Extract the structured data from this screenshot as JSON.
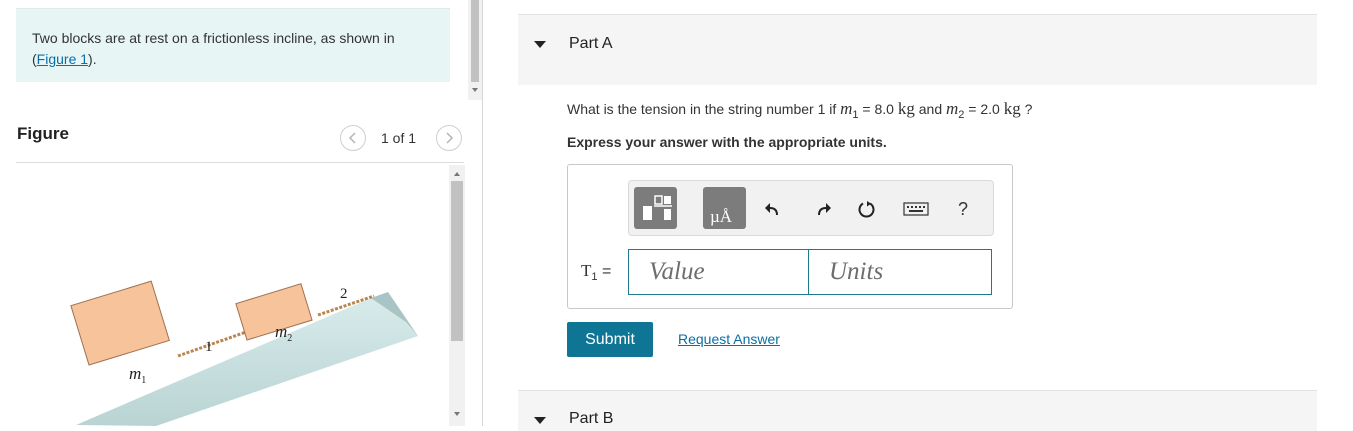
{
  "problem": {
    "text": "Two blocks are at rest on a frictionless incline, as shown in (",
    "link": "Figure 1",
    "suffix": ")."
  },
  "figure": {
    "title": "Figure",
    "counter": "1 of 1",
    "labels": {
      "mass1": "m",
      "mass1_sub": "1",
      "mass2": "m",
      "mass2_sub": "2",
      "string1": "1",
      "string2": "2"
    }
  },
  "part_a": {
    "label": "Part A",
    "question_prefix": "What is the tension in the string number 1 if ",
    "m1_var": "m",
    "m1_sub": "1",
    "eq1": " = 8.0 ",
    "unit1": "kg",
    "and": " and ",
    "m2_var": "m",
    "m2_sub": "2",
    "eq2": " = 2.0 ",
    "unit2": "kg",
    "q_end": " ?",
    "instruction": "Express your answer with the appropriate units.",
    "answer_label_var": "T",
    "answer_label_sub": "1",
    "answer_label_eq": " =",
    "value_placeholder": "Value",
    "units_placeholder": "Units",
    "toolbar_help": "?",
    "submit": "Submit",
    "request": "Request Answer"
  },
  "part_b": {
    "label": "Part B"
  },
  "colors": {
    "submit_bg": "#0f7595",
    "link": "#0a6ea8",
    "problem_bg": "#e8f5f5",
    "field_border": "#1e7a8c",
    "block_fill": "#f6c39a"
  }
}
